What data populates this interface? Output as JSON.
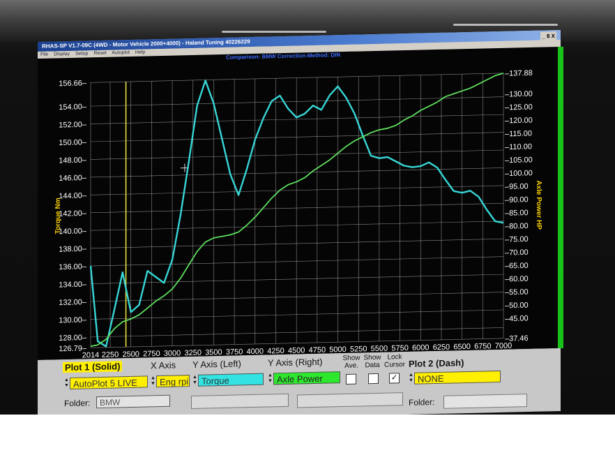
{
  "window": {
    "title": "RHAS-SP V1.7-09C  (4WD - Motor Vehicle 2000+4000) - Haland Tuning 40226229",
    "buttons": "_ 8 X",
    "menu": [
      "File",
      "Display",
      "Setup",
      "Reset",
      "Autoplot",
      "Help"
    ],
    "comparison": "Comparison: BMW   Correction-Method: DIN"
  },
  "colors": {
    "background": "#050505",
    "grid": "#bdbdbd",
    "torque": "#38d6d6",
    "power": "#5fe05f",
    "cursor": "#e6e040",
    "left_axis_label": "#ffd400",
    "right_axis_label": "#ffd400"
  },
  "chart_data": {
    "type": "line",
    "xlabel": "",
    "x_ticks": [
      "2014",
      "2250",
      "2500",
      "2750",
      "3000",
      "3250",
      "3500",
      "3750",
      "4000",
      "4250",
      "4500",
      "4750",
      "5000",
      "5250",
      "5500",
      "5750",
      "6000",
      "6250",
      "6500",
      "6750",
      "7000"
    ],
    "xlim": [
      2014,
      7000
    ],
    "ylabel_left": "Torque Nm",
    "ylim_left": [
      126.79,
      156.66
    ],
    "y_ticks_left": [
      "156.66",
      "154.00",
      "152.00",
      "150.00",
      "148.00",
      "146.00",
      "144.00",
      "142.00",
      "140.00",
      "138.00",
      "136.00",
      "134.00",
      "132.00",
      "130.00",
      "128.00",
      "126.79"
    ],
    "ylabel_right": "Axle Power HP",
    "ylim_right": [
      37.46,
      137.88
    ],
    "y_ticks_right": [
      "137.88",
      "130.00",
      "125.00",
      "120.00",
      "115.00",
      "110.00",
      "105.00",
      "100.00",
      "95.00",
      "90.00",
      "85.00",
      "80.00",
      "75.00",
      "70.00",
      "65.00",
      "60.00",
      "55.00",
      "50.00",
      "45.00",
      "37.46"
    ],
    "cursor_x": 2440,
    "grid": true,
    "series": [
      {
        "name": "Torque",
        "axis": "left",
        "x": [
          2014,
          2100,
          2200,
          2300,
          2400,
          2500,
          2600,
          2700,
          2800,
          2900,
          3000,
          3100,
          3200,
          3300,
          3400,
          3500,
          3600,
          3700,
          3800,
          3900,
          4000,
          4100,
          4200,
          4300,
          4400,
          4500,
          4600,
          4700,
          4800,
          4900,
          5000,
          5100,
          5200,
          5300,
          5400,
          5500,
          5600,
          5700,
          5800,
          5900,
          6000,
          6100,
          6200,
          6300,
          6400,
          6500,
          6600,
          6700,
          6800,
          6900,
          7000
        ],
        "values": [
          136.0,
          127.5,
          126.9,
          131.0,
          135.2,
          130.7,
          131.5,
          135.3,
          134.6,
          133.9,
          136.5,
          141.5,
          147.5,
          153.8,
          156.6,
          154.0,
          150.0,
          146.0,
          143.6,
          146.5,
          149.8,
          152.2,
          154.1,
          154.7,
          153.2,
          152.2,
          152.6,
          153.5,
          153.0,
          154.6,
          155.6,
          154.3,
          152.5,
          150.0,
          147.7,
          147.4,
          147.5,
          147.0,
          146.5,
          146.3,
          146.4,
          146.8,
          146.2,
          144.8,
          143.5,
          143.3,
          143.5,
          142.8,
          141.3,
          140.0,
          139.8
        ]
      },
      {
        "name": "Axle Power",
        "axis": "right",
        "x": [
          2014,
          2100,
          2200,
          2300,
          2400,
          2500,
          2600,
          2700,
          2800,
          2900,
          3000,
          3100,
          3200,
          3300,
          3400,
          3500,
          3600,
          3700,
          3800,
          3900,
          4000,
          4100,
          4200,
          4300,
          4400,
          4500,
          4600,
          4700,
          4800,
          4900,
          5000,
          5100,
          5200,
          5300,
          5400,
          5500,
          5600,
          5700,
          5800,
          5900,
          6000,
          6100,
          6200,
          6300,
          6400,
          6500,
          6600,
          6700,
          6800,
          6900,
          7000
        ],
        "values": [
          38.0,
          38.5,
          40.5,
          44.5,
          47.0,
          48.0,
          49.5,
          52.0,
          54.5,
          56.5,
          59.0,
          63.0,
          68.0,
          73.0,
          76.5,
          78.0,
          78.5,
          79.0,
          80.0,
          82.5,
          85.5,
          89.0,
          92.5,
          95.5,
          97.5,
          98.5,
          100.0,
          102.5,
          104.5,
          106.5,
          109.0,
          111.5,
          113.5,
          115.0,
          116.5,
          117.5,
          118.0,
          119.0,
          121.0,
          122.5,
          124.5,
          126.0,
          127.5,
          129.5,
          130.5,
          131.5,
          132.5,
          134.0,
          135.5,
          137.0,
          137.88
        ]
      }
    ]
  },
  "controls": {
    "plot1_label": "Plot 1 (Solid)",
    "x_axis_label": "X Axis",
    "y_left_label": "Y Axis (Left)",
    "y_right_label": "Y Axis (Right)",
    "show_ave_label": "Show Ave.",
    "show_data_label": "Show Data",
    "lock_cursor_label": "Lock Cursor",
    "plot2_label": "Plot 2 (Dash)",
    "plot1_value": "AutoPlot 5 LIVE",
    "x_axis_value": "Eng rpi",
    "y_left_value": "Torque",
    "y_right_value": "Axle Power",
    "plot2_value": "NONE",
    "lock_cursor_mark": "✓",
    "folder_label": "Folder:",
    "folder_value": "BMW",
    "folder2_label": "Folder:"
  }
}
